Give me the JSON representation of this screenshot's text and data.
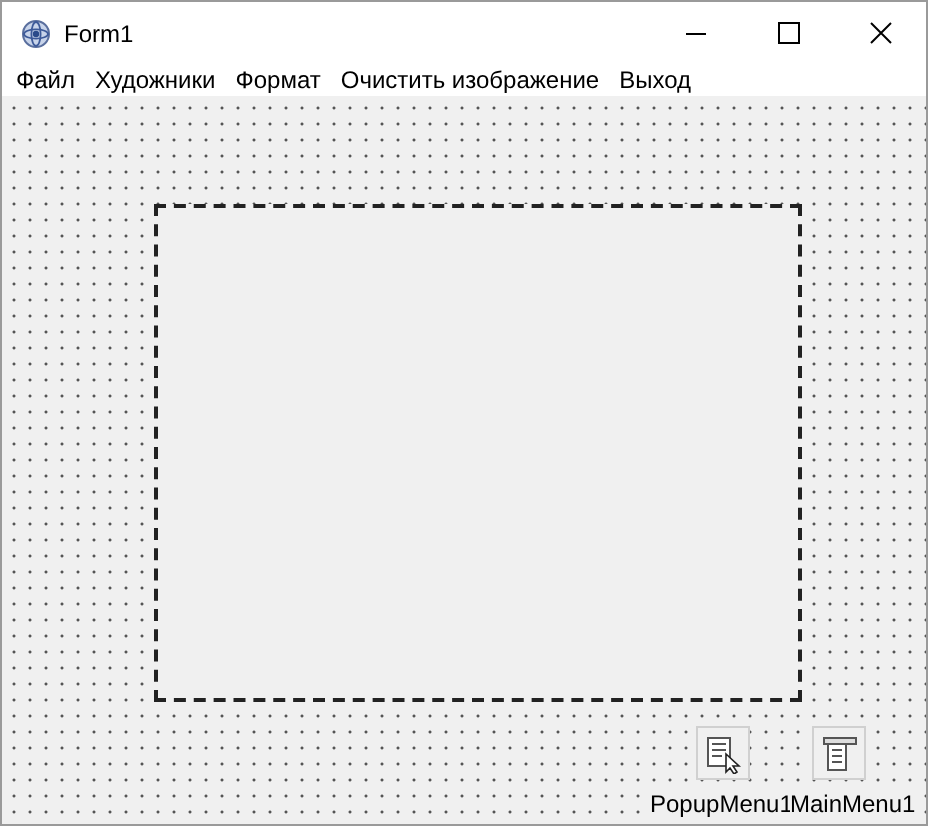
{
  "window": {
    "title": "Form1"
  },
  "menu": [
    "Файл",
    "Художники",
    "Формат",
    "Очистить изображение",
    "Выход"
  ],
  "components": [
    {
      "kind": "popup",
      "label": "PopupMenu1"
    },
    {
      "kind": "main",
      "label": "MainMenu1"
    }
  ]
}
